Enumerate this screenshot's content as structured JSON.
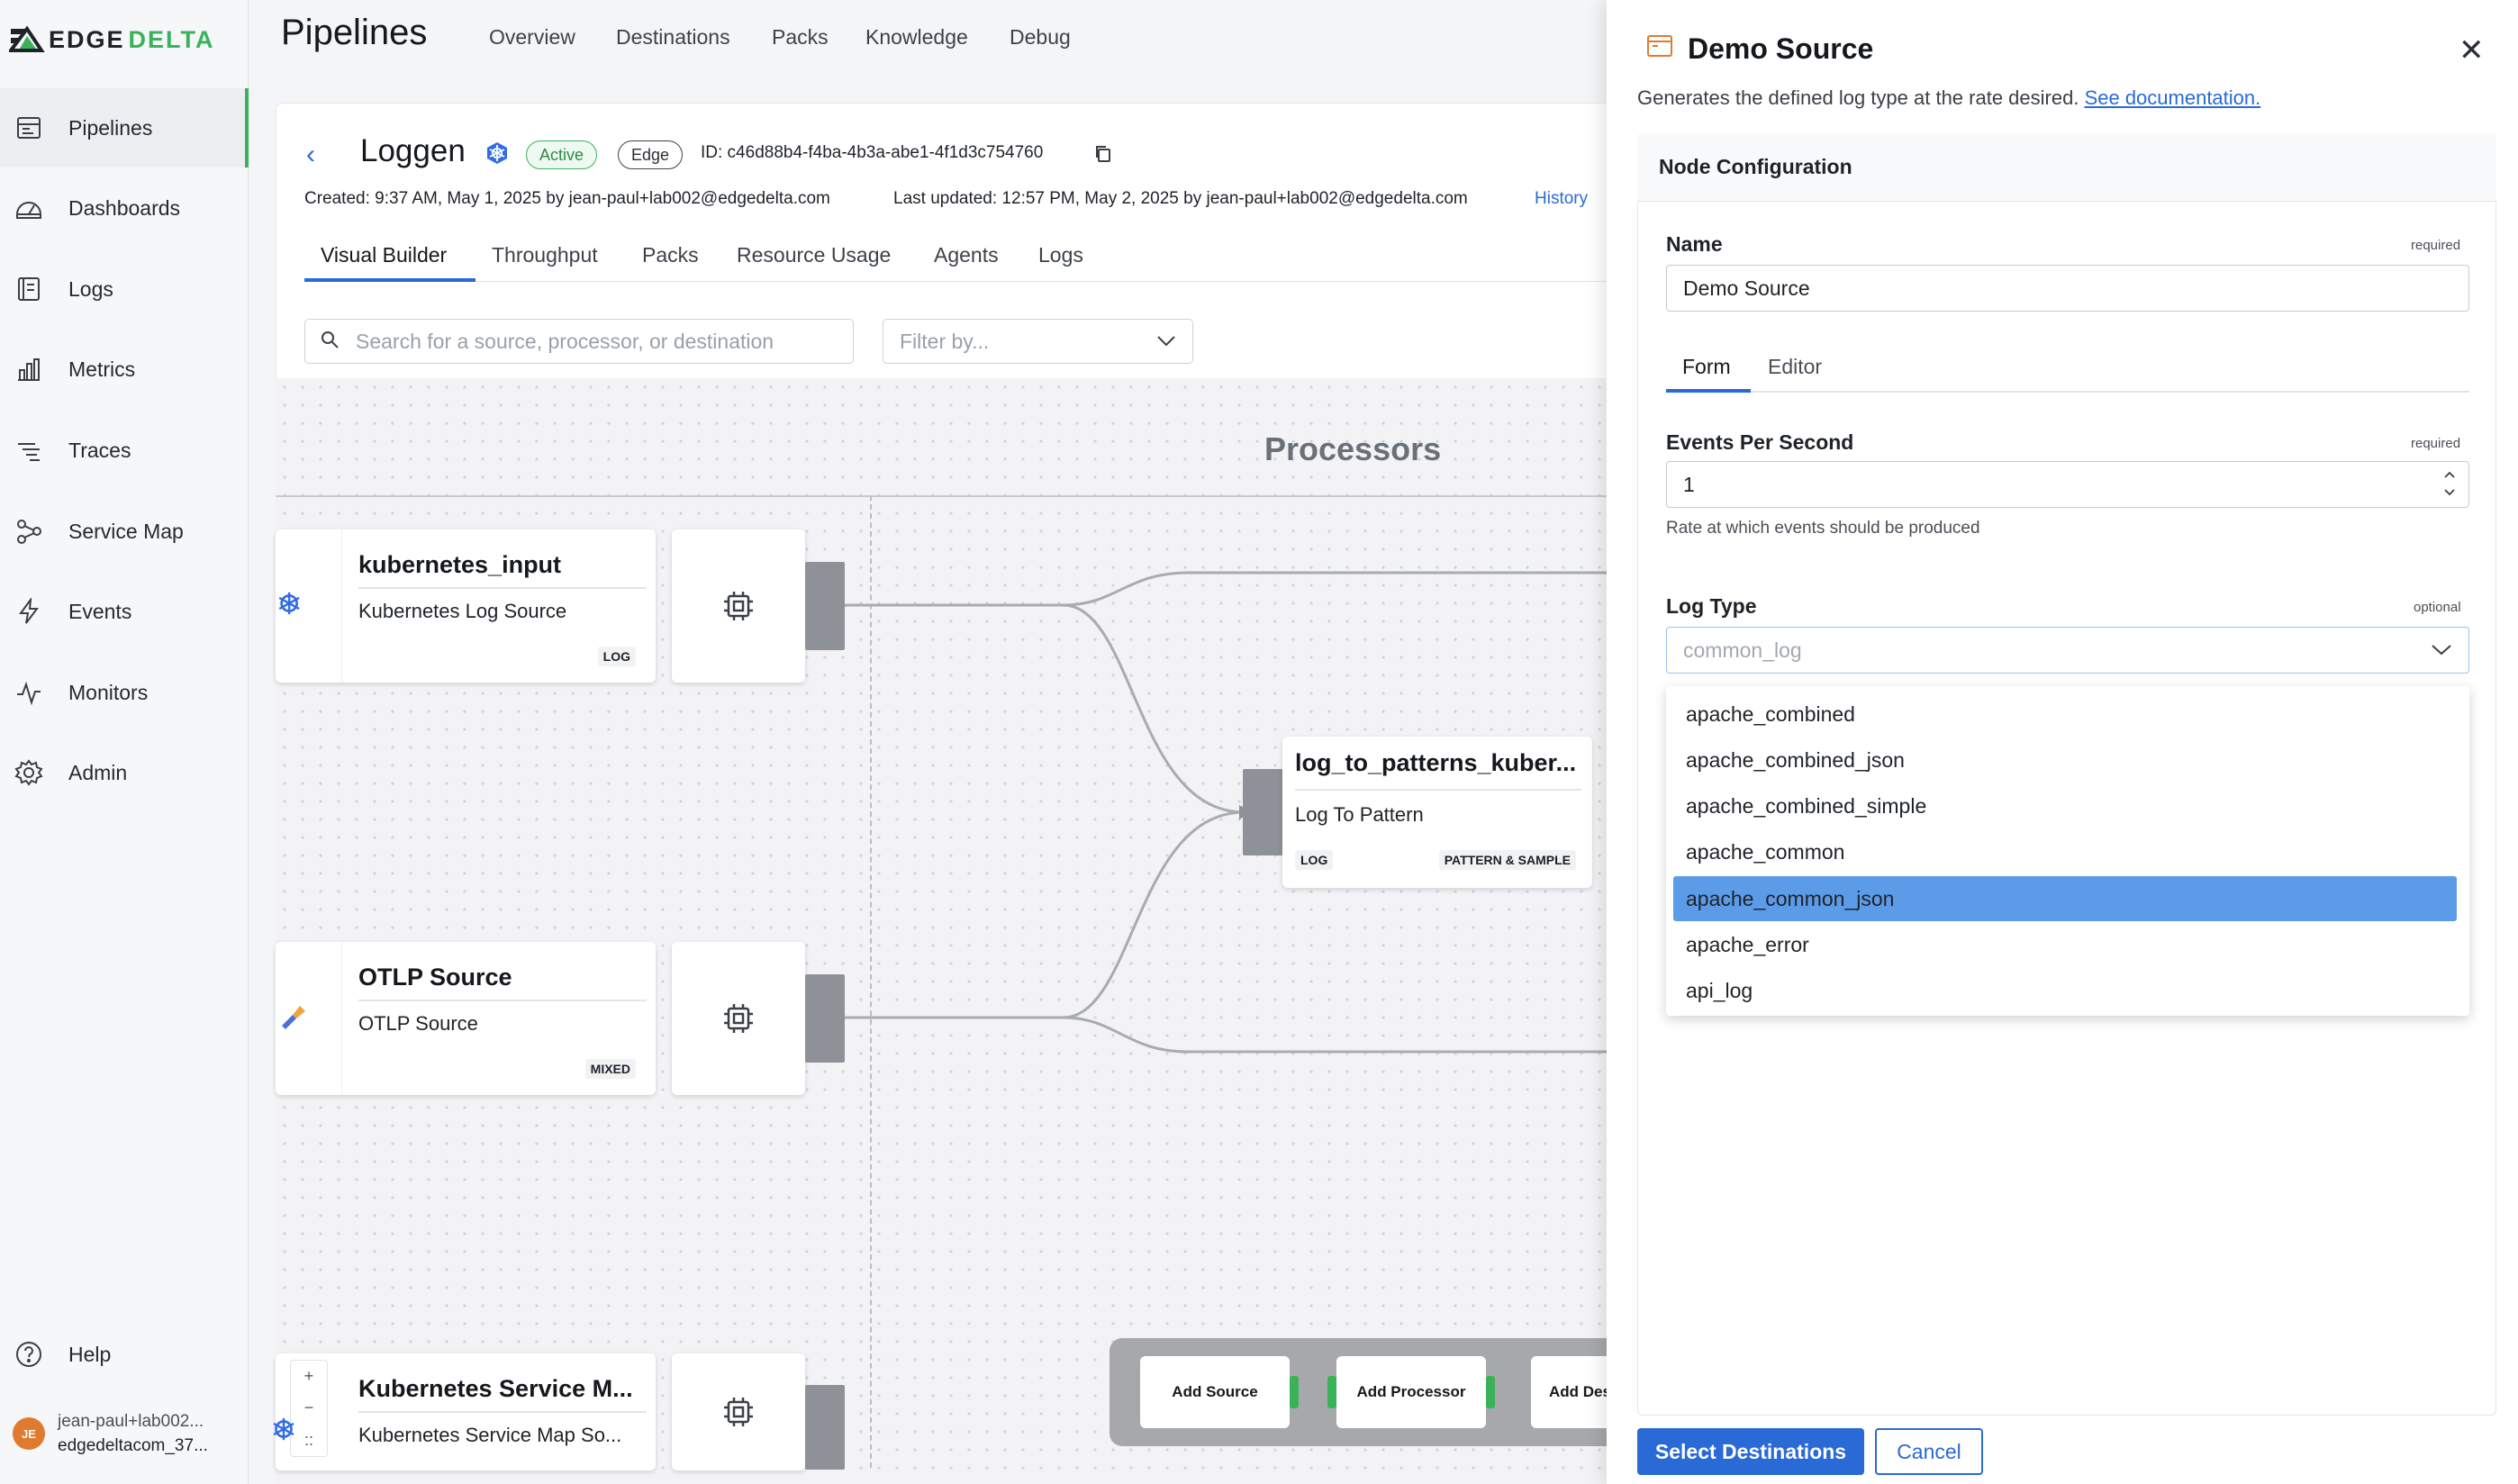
{
  "brand": {
    "part1": "EDGE",
    "part2": "DELTA"
  },
  "sidebar": {
    "items": [
      {
        "label": "Pipelines",
        "icon": "pipelines-icon"
      },
      {
        "label": "Dashboards",
        "icon": "dashboard-icon"
      },
      {
        "label": "Logs",
        "icon": "logs-icon"
      },
      {
        "label": "Metrics",
        "icon": "metrics-icon"
      },
      {
        "label": "Traces",
        "icon": "traces-icon"
      },
      {
        "label": "Service Map",
        "icon": "service-map-icon"
      },
      {
        "label": "Events",
        "icon": "events-icon"
      },
      {
        "label": "Monitors",
        "icon": "monitors-icon"
      },
      {
        "label": "Admin",
        "icon": "admin-icon"
      }
    ],
    "help": "Help",
    "user": {
      "initials": "JE",
      "name": "jean-paul+lab002...",
      "org": "edgedeltacom_37..."
    }
  },
  "header": {
    "title": "Pipelines",
    "tabs": [
      "Overview",
      "Destinations",
      "Packs",
      "Knowledge",
      "Debug"
    ]
  },
  "pipeline": {
    "name": "Loggen",
    "status": "Active",
    "env": "Edge",
    "id": "ID: c46d88b4-f4ba-4b3a-abe1-4f1d3c754760",
    "created": "Created: 9:37 AM, May 1, 2025 by jean-paul+lab002@edgedelta.com",
    "updated": "Last updated: 12:57 PM, May 2, 2025 by jean-paul+lab002@edgedelta.com",
    "history": "History",
    "subtabs": [
      "Visual Builder",
      "Throughput",
      "Packs",
      "Resource Usage",
      "Agents",
      "Logs"
    ],
    "search_placeholder": "Search for a source, processor, or destination",
    "filter_placeholder": "Filter by..."
  },
  "canvas": {
    "processors_header": "Processors",
    "nodes": [
      {
        "title": "kubernetes_input",
        "subtitle": "Kubernetes Log Source",
        "tag": "LOG"
      },
      {
        "title": "OTLP Source",
        "subtitle": "OTLP Source",
        "tag": "MIXED"
      },
      {
        "title": "Kubernetes Service M...",
        "subtitle": "Kubernetes Service Map So..."
      }
    ],
    "processor": {
      "title": "log_to_patterns_kuber...",
      "subtitle": "Log To Pattern",
      "tag1": "LOG",
      "tag2": "PATTERN & SAMPLE"
    },
    "zoom": {
      "in": "+",
      "out": "−",
      "fit": "::"
    },
    "add_buttons": [
      "Add Source",
      "Add Processor",
      "Add Des"
    ]
  },
  "drawer": {
    "title": "Demo Source",
    "description": "Generates the defined log type at the rate desired.",
    "doc_link": "See documentation.",
    "panel_title": "Node Configuration",
    "name_label": "Name",
    "name_required": "required",
    "name_value": "Demo Source",
    "tabs": [
      "Form",
      "Editor"
    ],
    "eps_label": "Events Per Second",
    "eps_required": "required",
    "eps_value": "1",
    "eps_help": "Rate at which events should be produced",
    "log_type_label": "Log Type",
    "log_type_optional": "optional",
    "log_type_placeholder": "common_log",
    "options": [
      "apache_combined",
      "apache_combined_json",
      "apache_combined_simple",
      "apache_common",
      "apache_common_json",
      "apache_error",
      "api_log"
    ],
    "selected_option": "apache_common_json",
    "select_button": "Select Destinations",
    "cancel_button": "Cancel"
  },
  "colors": {
    "accent": "#2a6ad6",
    "brand_green": "#3ab25a",
    "selected_option": "#5b9be8",
    "active_nav": "#3ab25a"
  }
}
